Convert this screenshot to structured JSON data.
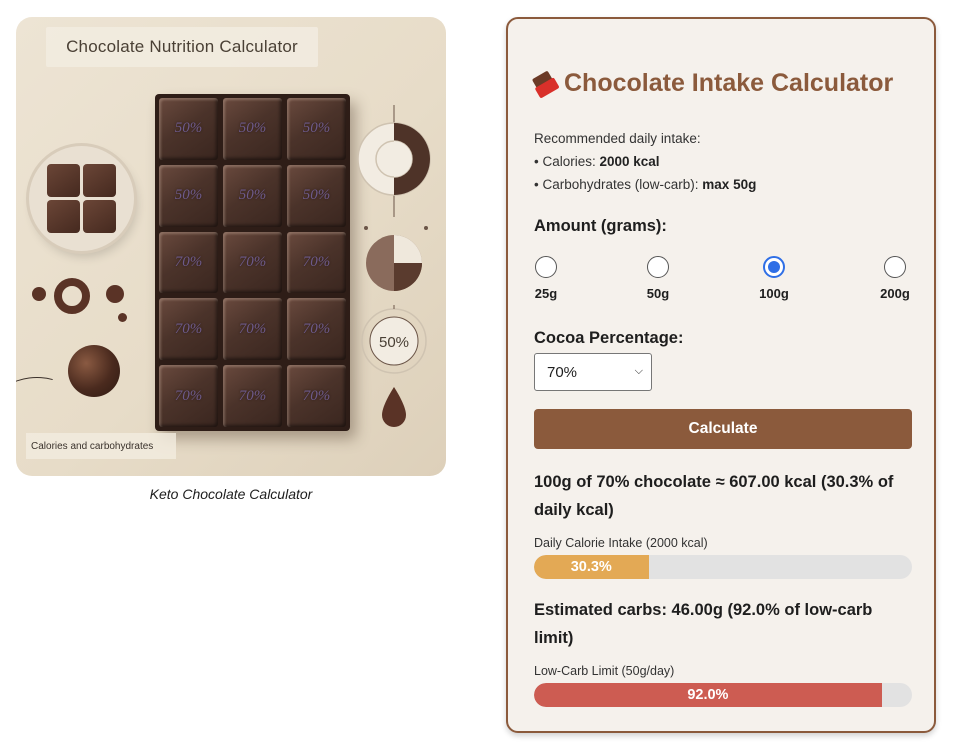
{
  "image_card": {
    "title": "Chocolate Nutrition Calculator",
    "bar_labels": [
      "50%",
      "50%",
      "50%",
      "50%",
      "50%",
      "50%",
      "70%",
      "70%",
      "70%",
      "70%",
      "70%",
      "70%",
      "70%",
      "70%",
      "70%"
    ],
    "gauge_label": "50%",
    "footer": "Calories and carbohydrates",
    "caption": "Keto Chocolate Calculator"
  },
  "calculator": {
    "title": "Chocolate Intake Calculator",
    "recommended": {
      "heading": "Recommended daily intake:",
      "calories_prefix": "• Calories: ",
      "calories_value": "2000 kcal",
      "carbs_prefix": "• Carbohydrates (low-carb): ",
      "carbs_value": "max 50g"
    },
    "amount_label": "Amount (grams):",
    "amount_options": [
      "25g",
      "50g",
      "100g",
      "200g"
    ],
    "amount_selected": "100g",
    "cocoa_label": "Cocoa Percentage:",
    "cocoa_selected": "70%",
    "calculate_label": "Calculate",
    "result_kcal": "100g of 70% chocolate ≈ 607.00 kcal (30.3% of daily kcal)",
    "kcal_bar_label": "Daily Calorie Intake (2000 kcal)",
    "kcal_percent": 30.3,
    "kcal_percent_text": "30.3%",
    "result_carbs": "Estimated carbs: 46.00g (92.0% of low-carb limit)",
    "carbs_bar_label": "Low-Carb Limit (50g/day)",
    "carbs_percent": 92.0,
    "carbs_percent_text": "92.0%"
  },
  "colors": {
    "accent": "#8b5a3c",
    "radio_selected": "#2f6fe6",
    "kcal_bar": "#e3a955",
    "carbs_bar": "#cd5c52",
    "track": "#e2e2e2"
  }
}
